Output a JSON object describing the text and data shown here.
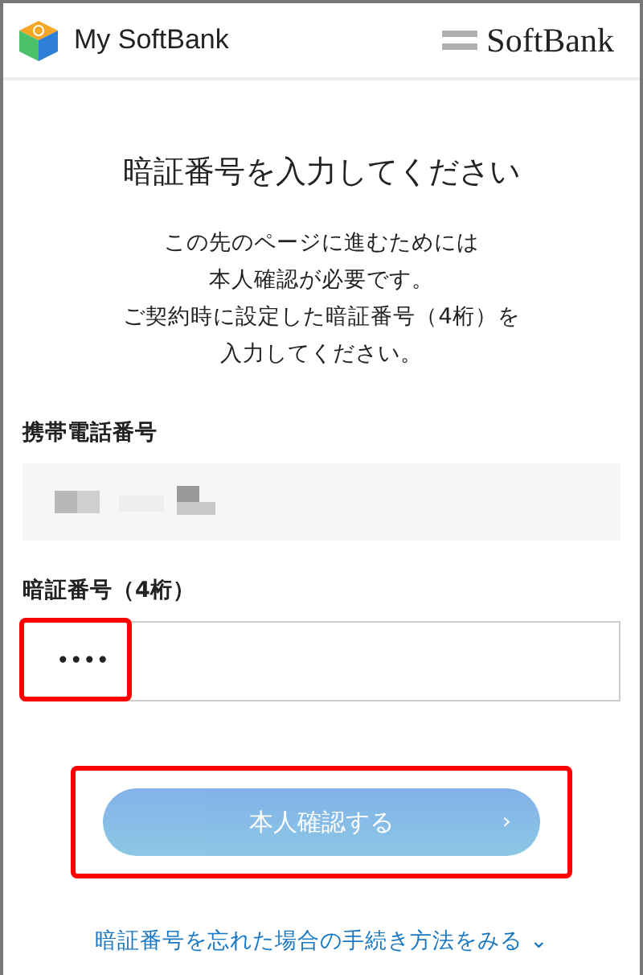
{
  "header": {
    "app_name": "My SoftBank",
    "brand": "SoftBank"
  },
  "title": "暗証番号を入力してください",
  "description_lines": [
    "この先のページに進むためには",
    "本人確認が必要です。",
    "ご契約時に設定した暗証番号（4桁）を",
    "入力してください。"
  ],
  "phone": {
    "label": "携帯電話番号",
    "masked": true
  },
  "pin": {
    "label": "暗証番号（4桁）",
    "value": "••••",
    "highlighted": true
  },
  "submit": {
    "label": "本人確認する",
    "arrow": "›",
    "disabled": true,
    "highlighted": true
  },
  "help_link": {
    "label": "暗証番号を忘れた場合の手続き方法をみる",
    "caret": "⌄"
  }
}
